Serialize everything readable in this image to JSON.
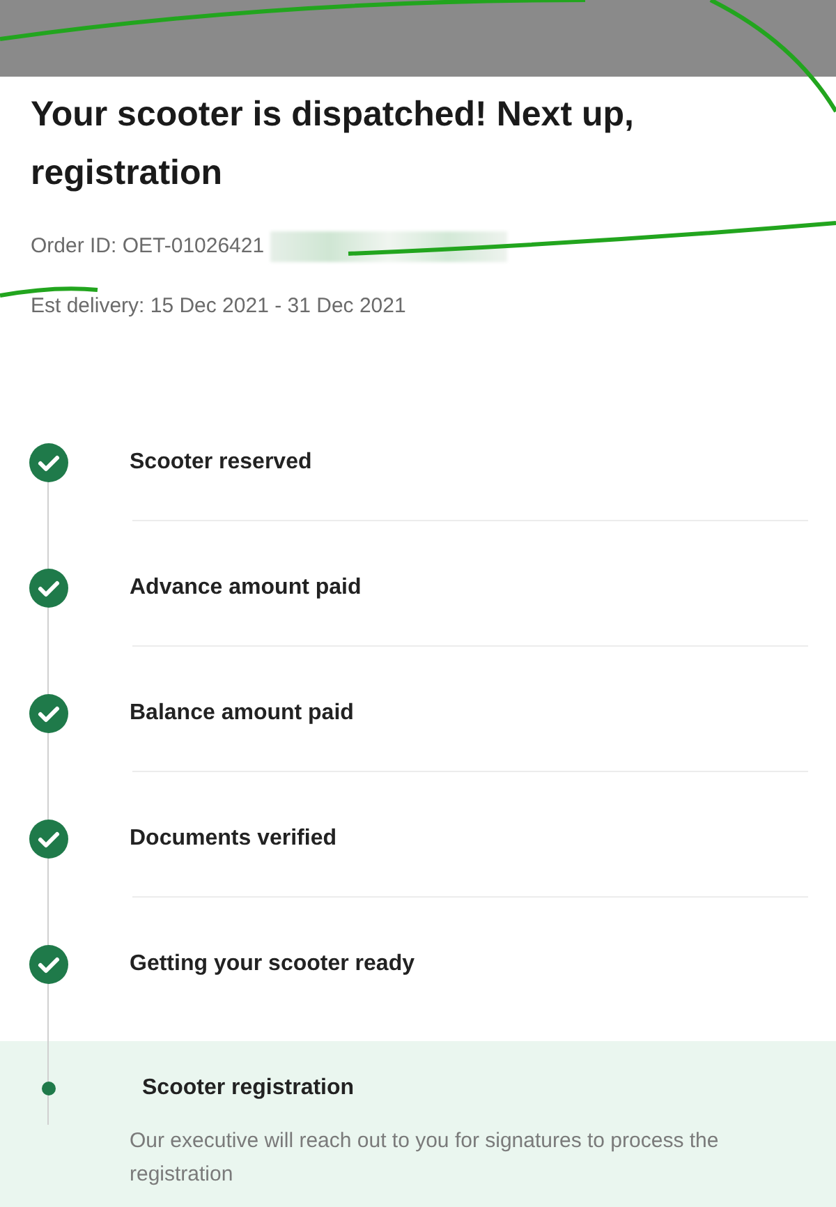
{
  "title": "Your scooter is dispatched! Next up, registration",
  "order_id": "Order ID: OET-01026421",
  "delivery": "Est delivery: 15 Dec 2021 - 31 Dec 2021",
  "steps": [
    {
      "label": "Scooter reserved",
      "kind": "done"
    },
    {
      "label": "Advance amount paid",
      "kind": "done"
    },
    {
      "label": "Balance amount paid",
      "kind": "done"
    },
    {
      "label": "Documents verified",
      "kind": "done"
    },
    {
      "label": "Getting your scooter ready",
      "kind": "done"
    },
    {
      "label": "Scooter registration",
      "kind": "current",
      "description": "Our executive will reach out to you for signatures to process the registration"
    }
  ]
}
